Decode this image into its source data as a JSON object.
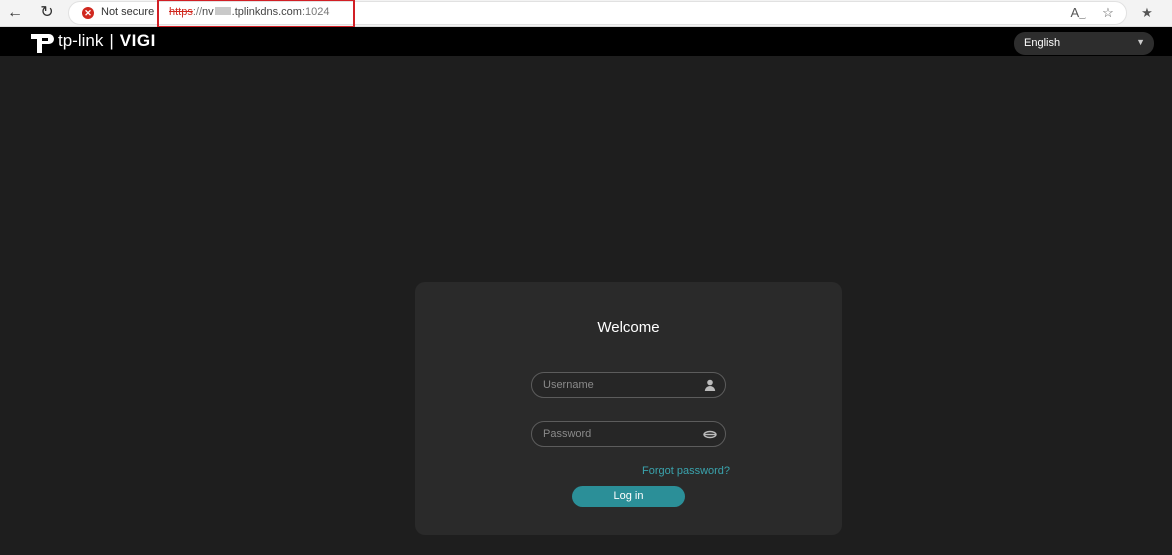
{
  "browser": {
    "security_label": "Not secure",
    "url_scheme": "https",
    "url_sep": "://",
    "url_host_prefix": "nv",
    "url_host_suffix": ".tplinkdns.com",
    "url_port": ":1024"
  },
  "header": {
    "brand": "tp-link",
    "divider": "|",
    "product": "VIGI",
    "language": "English"
  },
  "login": {
    "title": "Welcome",
    "username_placeholder": "Username",
    "password_placeholder": "Password",
    "forgot_link": "Forgot password?",
    "login_button": "Log in"
  },
  "colors": {
    "accent": "#2b8f98",
    "link": "#3aa3ad",
    "highlight_box": "#d21f25",
    "background": "#1e1e1e"
  },
  "icons": [
    "back-icon",
    "reload-icon",
    "not-secure-icon",
    "read-aloud-icon",
    "favorite-icon",
    "favorites-bar-icon",
    "user-icon",
    "eye-hidden-icon",
    "chevron-down-icon"
  ]
}
